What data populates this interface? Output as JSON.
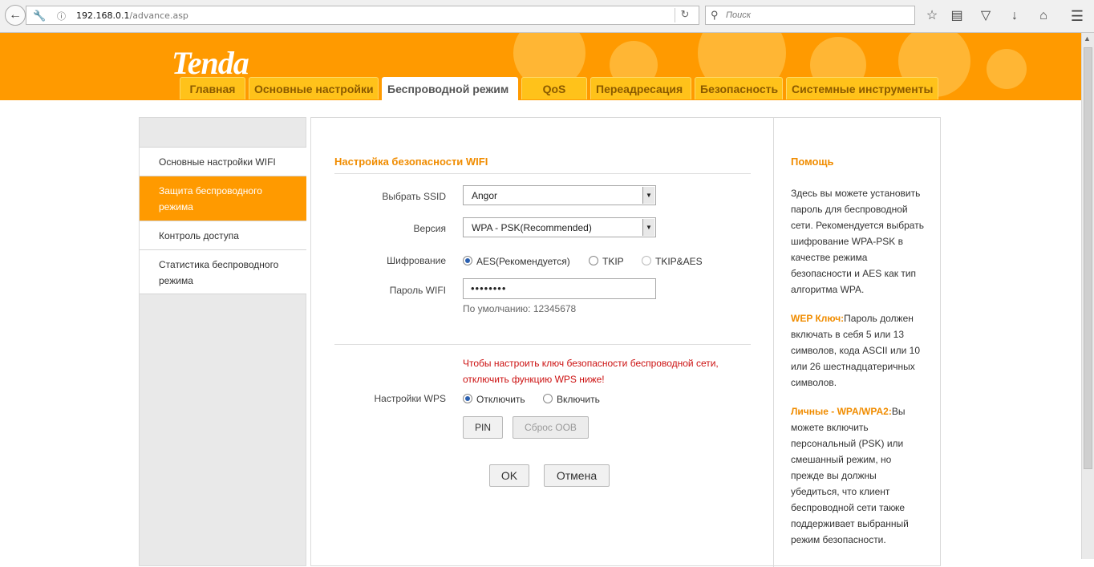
{
  "browser": {
    "url_host": "192.168.0.1",
    "url_path": "/advance.asp",
    "search_placeholder": "Поиск"
  },
  "router": {
    "logo": "Tenda",
    "tabs": [
      {
        "label": "Главная"
      },
      {
        "label": "Основные настройки"
      },
      {
        "label": "Беспроводной режим"
      },
      {
        "label": "QoS"
      },
      {
        "label": "Переадресация"
      },
      {
        "label": "Безопасность"
      },
      {
        "label": "Системные инструменты"
      }
    ],
    "active_tab": "Беспроводной режим",
    "sidebar": [
      {
        "label": "Основные настройки WIFI"
      },
      {
        "label": "Защита беспроводного режима"
      },
      {
        "label": "Контроль доступа"
      },
      {
        "label": "Статистика беспроводного режима"
      }
    ],
    "form": {
      "title": "Настройка безопасности WIFI",
      "ssid_label": "Выбрать SSID",
      "ssid_value": "Angor",
      "version_label": "Версия",
      "version_value": "WPA - PSK(Recommended)",
      "cipher_label": "Шифрование",
      "cipher_options": [
        "AES(Рекомендуется)",
        "TKIP",
        "TKIP&AES"
      ],
      "cipher_selected": "AES(Рекомендуется)",
      "password_label": "Пароль WIFI",
      "password_value": "••••••••",
      "default_hint": "По умолчанию: 12345678",
      "wps_warning_1": "Чтобы настроить ключ безопасности беспроводной сети,",
      "wps_warning_2": "отключить функцию WPS ниже!",
      "wps_label": "Настройки WPS",
      "wps_options": [
        "Отключить",
        "Включить"
      ],
      "wps_selected": "Отключить",
      "pin_button": "PIN",
      "reset_oob_button": "Сброс OOB",
      "ok_button": "OK",
      "cancel_button": "Отмена"
    },
    "help": {
      "title": "Помощь",
      "p1": "Здесь вы можете установить пароль для беспроводной сети. Рекомендуется выбрать шифрование WPA-PSK в качестве режима безопасности и AES как тип алгоритма WPA.",
      "wep_key": "WEP Ключ:",
      "wep_text": "Пароль должен включать в себя 5 или 13 символов, кода ASCII или 10 или 26 шестнадцатеричных символов.",
      "wpa_key": "Личные - WPA/WPA2:",
      "wpa_text": "Вы можете включить персональный (PSK) или смешанный режим, но прежде вы должны убедиться, что клиент беспроводной сети также поддерживает выбранный режим безопасности."
    }
  }
}
